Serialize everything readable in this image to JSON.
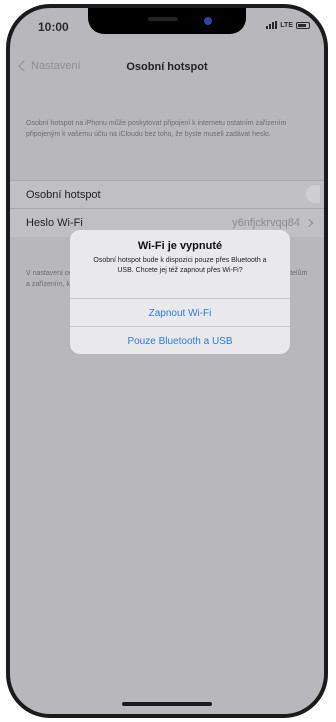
{
  "status_bar": {
    "time": "10:00",
    "carrier": "LTE",
    "signal_icon": "signal-icon",
    "battery_icon": "battery-icon"
  },
  "navbar": {
    "back_label": "Nastavení",
    "title": "Osobní hotspot"
  },
  "header_text": "Osobní hotspot na iPhonu může poskytovat připojení k internetu ostatním zařízením připojeným k vašemu účtu na iCloudu bez toho, že byste museli zadávat heslo.",
  "rows": [
    {
      "label": "Osobní hotspot",
      "value": ""
    },
    {
      "label": "Heslo Wi-Fi",
      "value": "y6nfjckrvqq84"
    }
  ],
  "footer_text": "V nastavení osobního hotspotu nebo v Ovládacím centru můžete povolit dalším uživatelům a zařízením, která nejsou přihlášena...",
  "alert": {
    "title": "Wi-Fi je vypnuté",
    "message": "Osobní hotspot bude k dispozici pouze přes Bluetooth a USB. Chcete jej též zapnout přes Wi-Fi?",
    "buttons": [
      "Zapnout Wi-Fi",
      "Pouze Bluetooth a USB"
    ]
  },
  "colors": {
    "accent": "#2a7bd8",
    "dimmed_background": "#b8b8bc"
  }
}
